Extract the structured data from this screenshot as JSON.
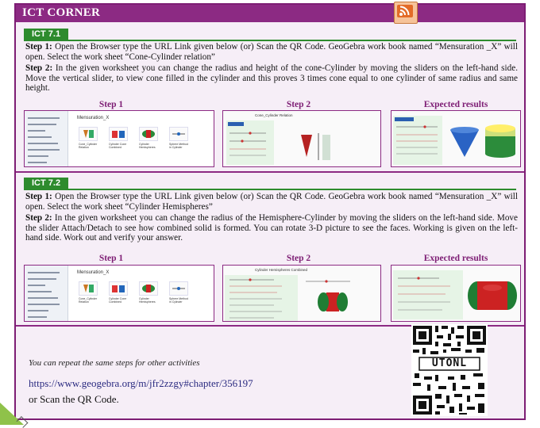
{
  "header": {
    "title": "ICT CORNER",
    "icon": "rss-feed-icon"
  },
  "sections": [
    {
      "tag": "ICT 7.1",
      "step1_label": "Step 1:",
      "step1_text": " Open the Browser type the URL Link given below (or) Scan the QR Code. GeoGebra work book named “Mensuration _X” will open. Select the work sheet “Cone-Cylinder relation”",
      "step2_label": "Step 2:",
      "step2_text": " In the given worksheet you can change the radius and height of the cone-Cylinder by moving the sliders on the left-hand side. Move the vertical slider, to view cone filled in the cylinder and this proves 3 times cone equal to one cylinder of same radius and same height.",
      "captions": [
        "Step 1",
        "Step 2",
        "Expected results"
      ],
      "thumb_title": "Mensuration_X",
      "tiles": [
        "Cone_Cylinder Relation",
        "Cylinder Cone Combined",
        "Cylinder Hemispheres",
        "Sphere Method in Cylinder"
      ],
      "step2_title": "Cone_Cylinder Relation"
    },
    {
      "tag": "ICT 7.2",
      "step1_label": "Step 1:",
      "step1_text": " Open the Browser type the URL Link given below (or) Scan the QR Code. GeoGebra work book named “Mensuration _X” will open. Select the work sheet “Cylinder Hemispheres”",
      "step2_label": "Step 2:",
      "step2_text": " In the given worksheet you can change the radius of the Hemisphere-Cylinder by moving the sliders on the left-hand side. Move the slider Attach/Detach to see how combined solid is formed. You can rotate 3-D picture to see the faces. Working is given on the left-hand side. Work out and verify your answer.",
      "captions": [
        "Step 1",
        "Step 2",
        "Expected results"
      ],
      "thumb_title": "Mensuration_X",
      "tiles": [
        "Cone_Cylinder Relation",
        "Cylinder Cone Combined",
        "Cylinder Hemispheres",
        "Sphere Method in Cylinder"
      ],
      "step2_title": "Cylinder Hemispheres Combined"
    }
  ],
  "footer": {
    "repeat_note": "You can repeat the same steps for other activities",
    "url": "https://www.geogebra.org/m/jfr2zzgy#chapter/356197",
    "scan_text": "or Scan the QR Code.",
    "qr_label": "UTONL"
  },
  "colors": {
    "header": "#8c2a83",
    "tag": "#2e8b2e",
    "caption": "#7d1d74",
    "panel": "#f6eef7"
  }
}
